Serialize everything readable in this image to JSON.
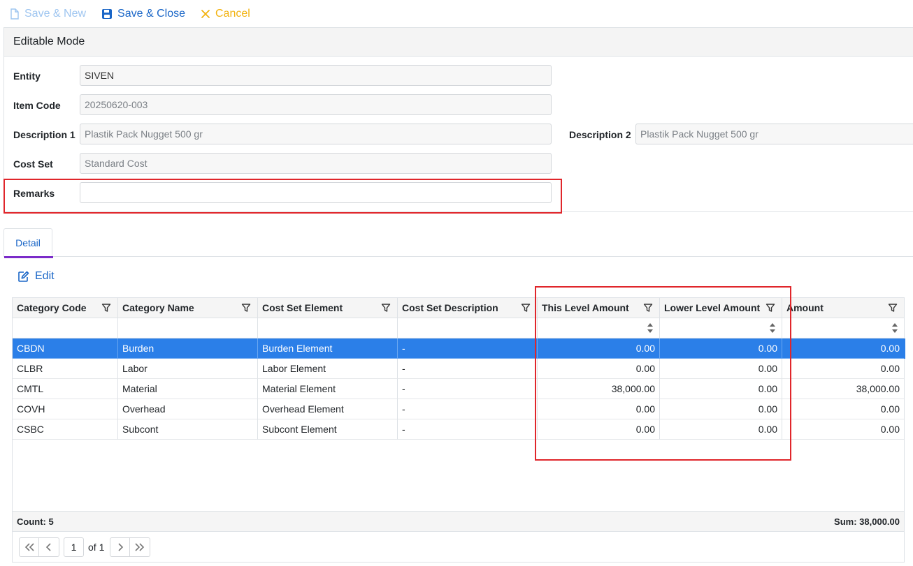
{
  "toolbar": {
    "save_new_label": "Save & New",
    "save_close_label": "Save & Close",
    "cancel_label": "Cancel"
  },
  "panel": {
    "title": "Editable Mode",
    "fields": {
      "entity": {
        "label": "Entity",
        "value": "SIVEN"
      },
      "item_code": {
        "label": "Item Code",
        "value": "20250620-003"
      },
      "description1": {
        "label": "Description 1",
        "value": "Plastik Pack Nugget 500 gr"
      },
      "description2": {
        "label": "Description 2",
        "value": "Plastik Pack Nugget 500 gr"
      },
      "cost_set": {
        "label": "Cost Set",
        "value": "Standard Cost"
      },
      "remarks": {
        "label": "Remarks",
        "value": ""
      }
    }
  },
  "tabs": [
    {
      "label": "Detail"
    }
  ],
  "edit_label": "Edit",
  "grid": {
    "columns": [
      "Category Code",
      "Category Name",
      "Cost Set Element",
      "Cost Set Description",
      "This Level Amount",
      "Lower Level Amount",
      "Amount"
    ],
    "rows": [
      {
        "code": "CBDN",
        "name": "Burden",
        "element": "Burden Element",
        "desc": "-",
        "this_level": "0.00",
        "lower_level": "0.00",
        "amount": "0.00",
        "selected": true
      },
      {
        "code": "CLBR",
        "name": "Labor",
        "element": "Labor Element",
        "desc": "-",
        "this_level": "0.00",
        "lower_level": "0.00",
        "amount": "0.00",
        "selected": false
      },
      {
        "code": "CMTL",
        "name": "Material",
        "element": "Material Element",
        "desc": "-",
        "this_level": "38,000.00",
        "lower_level": "0.00",
        "amount": "38,000.00",
        "selected": false
      },
      {
        "code": "COVH",
        "name": "Overhead",
        "element": "Overhead Element",
        "desc": "-",
        "this_level": "0.00",
        "lower_level": "0.00",
        "amount": "0.00",
        "selected": false
      },
      {
        "code": "CSBC",
        "name": "Subcont",
        "element": "Subcont Element",
        "desc": "-",
        "this_level": "0.00",
        "lower_level": "0.00",
        "amount": "0.00",
        "selected": false
      }
    ],
    "footer": {
      "count": "Count: 5",
      "sum": "Sum: 38,000.00"
    }
  },
  "pager": {
    "page": "1",
    "of_label": "of 1"
  },
  "colors": {
    "primary": "#1a66c7",
    "selected_row": "#2b7fe8",
    "highlight": "#e0262b",
    "warning": "#f2b20f",
    "tab_accent": "#7b2bc9"
  }
}
